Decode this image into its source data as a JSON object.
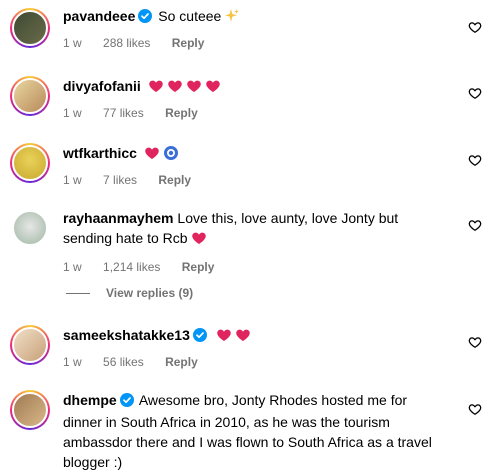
{
  "comments": [
    {
      "username": "pavandeee",
      "verified": true,
      "text": "So cuteee",
      "emojis": [
        "sparkles-emoji"
      ],
      "time": "1 w",
      "likes": "288 likes",
      "reply": "Reply"
    },
    {
      "username": "divyafofanii",
      "verified": false,
      "text": "",
      "emojis": [
        "heart-emoji",
        "heart-emoji",
        "heart-emoji",
        "heart-emoji"
      ],
      "time": "1 w",
      "likes": "77 likes",
      "reply": "Reply"
    },
    {
      "username": "wtfkarthicc",
      "verified": false,
      "text": "",
      "emojis": [
        "heart-emoji",
        "blue-circle-emoji"
      ],
      "time": "1 w",
      "likes": "7 likes",
      "reply": "Reply"
    },
    {
      "username": "rayhaanmayhem",
      "verified": false,
      "text": "Love this, love aunty, love Jonty but sending hate to Rcb",
      "emojis": [
        "heart-emoji"
      ],
      "time": "1 w",
      "likes": "1,214 likes",
      "reply": "Reply"
    },
    {
      "username": "sameekshatakke13",
      "verified": true,
      "text": "",
      "emojis": [
        "heart-emoji",
        "heart-emoji"
      ],
      "time": "1 w",
      "likes": "56 likes",
      "reply": "Reply"
    },
    {
      "username": "dhempe",
      "verified": true,
      "text": "Awesome bro, Jonty Rhodes hosted me for dinner in South Africa in 2010, as he was the tourism ambassdor there and I was flown to South Africa as a travel blogger :)",
      "emojis": [],
      "time": "",
      "likes": "",
      "reply": ""
    }
  ],
  "view_replies": "View replies (9)",
  "colors": {
    "secondary": "#737373",
    "verified": "#0095f6",
    "heart": "#e0245e"
  }
}
